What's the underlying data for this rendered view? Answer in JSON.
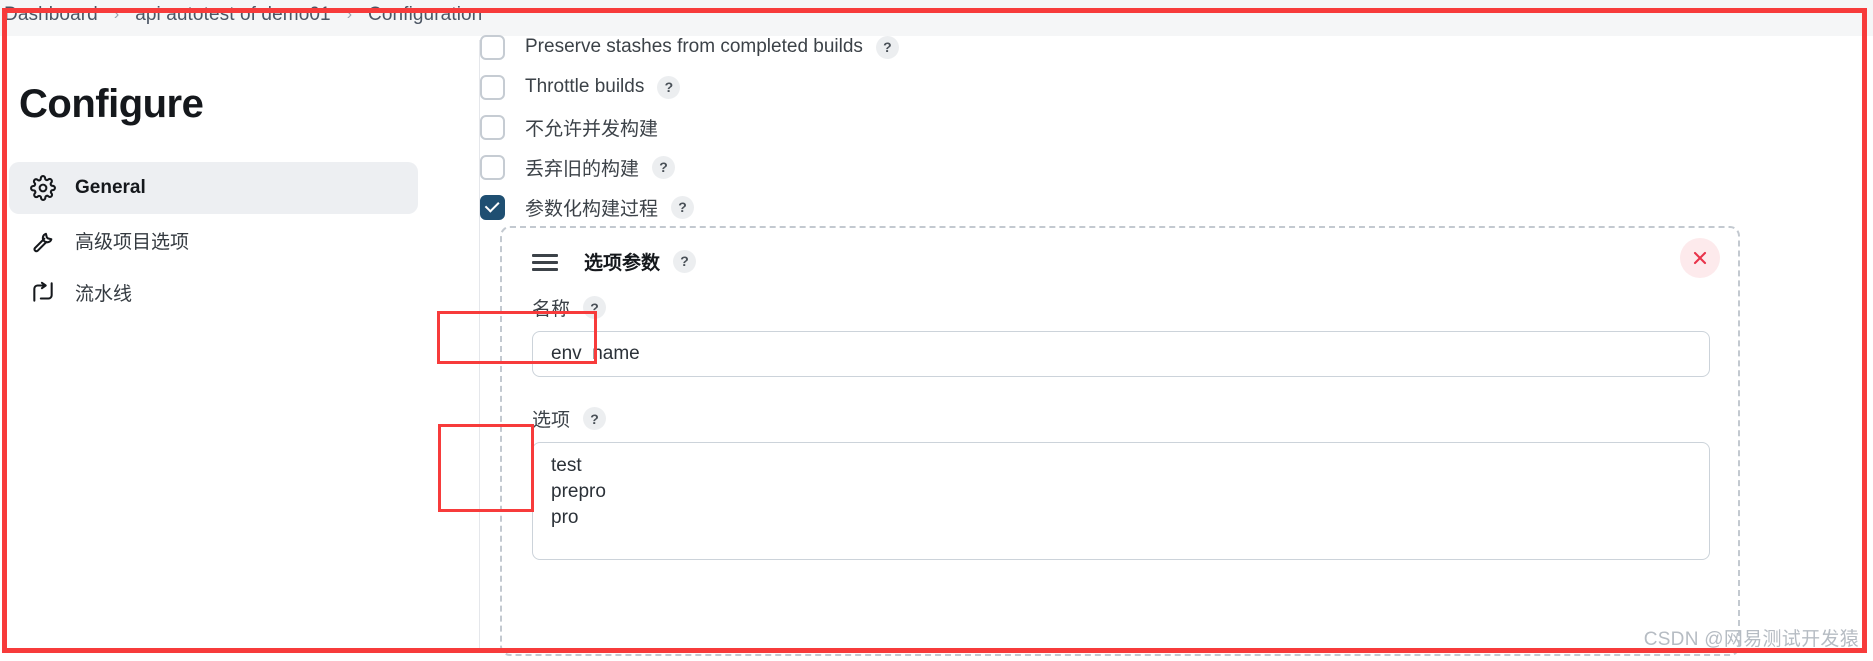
{
  "breadcrumb": {
    "items": [
      {
        "label": "Dashboard"
      },
      {
        "label": "api autotest of demo01"
      },
      {
        "label": "Configuration"
      }
    ],
    "separator": "›"
  },
  "sidebar": {
    "title": "Configure",
    "items": [
      {
        "label": "General",
        "icon": "gear-icon",
        "active": true
      },
      {
        "label": "高级项目选项",
        "icon": "wrench-icon",
        "active": false
      },
      {
        "label": "流水线",
        "icon": "pipeline-icon",
        "active": false
      }
    ]
  },
  "main": {
    "checkboxes": [
      {
        "label": "Preserve stashes from completed builds",
        "checked": false,
        "help": "?"
      },
      {
        "label": "Throttle builds",
        "checked": false,
        "help": "?"
      },
      {
        "label": "不允许并发构建",
        "checked": false,
        "help": ""
      },
      {
        "label": "丢弃旧的构建",
        "checked": false,
        "help": "?"
      },
      {
        "label": "参数化构建过程",
        "checked": true,
        "help": "?"
      }
    ],
    "parameter_panel": {
      "title": "选项参数",
      "title_help": "?",
      "drag_handle_icon": "drag-handle-icon",
      "close_icon": "close-icon",
      "fields": {
        "name": {
          "label": "名称",
          "help": "?",
          "value": "env_name",
          "placeholder": ""
        },
        "choices": {
          "label": "选项",
          "help": "?",
          "value": "test\nprepro\npro",
          "placeholder": ""
        }
      }
    }
  },
  "watermark": {
    "text": "CSDN @网易测试开发猿"
  },
  "colors": {
    "annotation_red": "#f73b3b",
    "checkbox_checked": "#1f4f72",
    "close_red": "#e8334a",
    "sidebar_active_bg": "#edeff2",
    "breadcrumb_bg": "#f5f6f7"
  }
}
